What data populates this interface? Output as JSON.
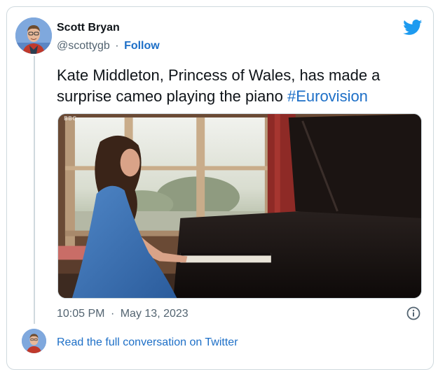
{
  "tweet": {
    "author": {
      "name": "Scott Bryan",
      "handle": "@scottygb",
      "separator": "·",
      "follow_label": "Follow"
    },
    "text_main": "Kate Middleton, Princess of Wales, has made a surprise cameo playing the piano ",
    "hashtag": "#Eurovision",
    "media": {
      "watermark": "BBC",
      "description_icon": "video-still"
    },
    "time": "10:05 PM",
    "date_separator": "·",
    "date": "May 13, 2023",
    "read_conversation": "Read the full conversation on Twitter"
  },
  "icons": {
    "brand": "twitter-bird-icon",
    "info": "info-icon"
  },
  "colors": {
    "link": "#1d6fc7",
    "text": "#0f1419",
    "muted": "#536471",
    "border": "#cfd9de",
    "twitter_blue": "#1d9bf0"
  }
}
